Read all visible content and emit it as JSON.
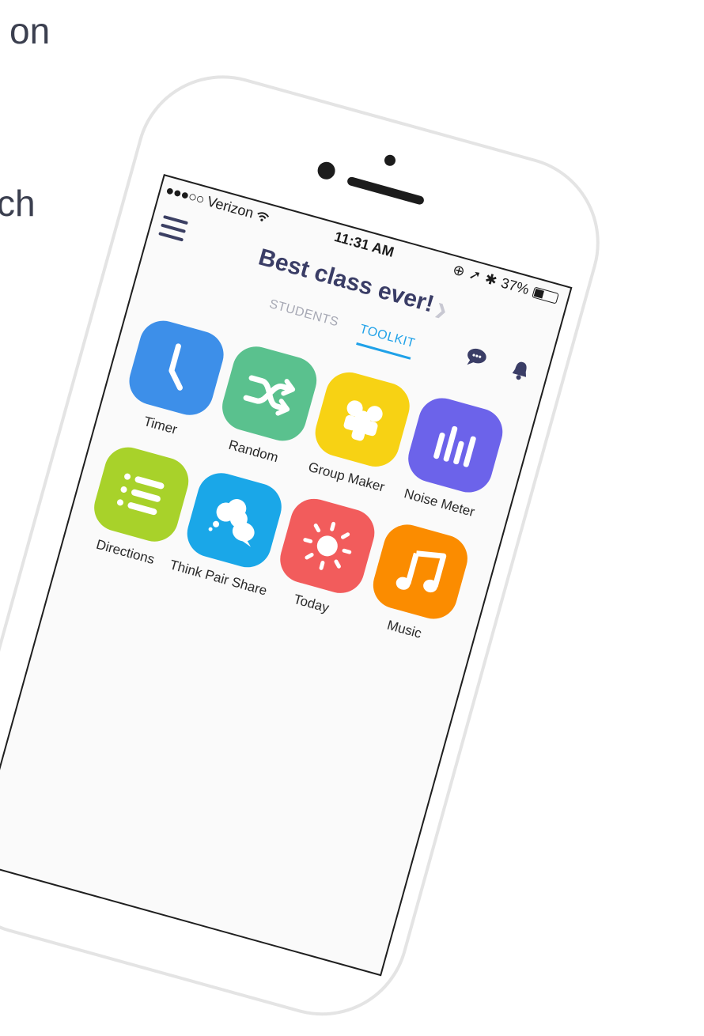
{
  "background": {
    "line1": "on",
    "line2": "ch"
  },
  "status_bar": {
    "signal": "●●●○○",
    "carrier": "Verizon",
    "time": "11:31 AM",
    "battery": "37%",
    "battery_level": 0.37
  },
  "header": {
    "class_name": "Best class ever!"
  },
  "tabs": [
    {
      "label": "STUDENTS",
      "active": false
    },
    {
      "label": "TOOLKIT",
      "active": true
    }
  ],
  "tools": [
    {
      "label": "Timer",
      "color": "#3d8fe9",
      "icon": "clock-icon"
    },
    {
      "label": "Random",
      "color": "#5ac18e",
      "icon": "shuffle-icon"
    },
    {
      "label": "Group Maker",
      "color": "#f7d214",
      "icon": "group-icon"
    },
    {
      "label": "Noise Meter",
      "color": "#6c63ea",
      "icon": "bars-icon"
    },
    {
      "label": "Directions",
      "color": "#a8d22a",
      "icon": "list-icon"
    },
    {
      "label": "Think Pair Share",
      "color": "#1aa7e8",
      "icon": "speech-bubbles-icon"
    },
    {
      "label": "Today",
      "color": "#f25c5c",
      "icon": "sun-icon"
    },
    {
      "label": "Music",
      "color": "#fb8c00",
      "icon": "music-note-icon"
    }
  ]
}
